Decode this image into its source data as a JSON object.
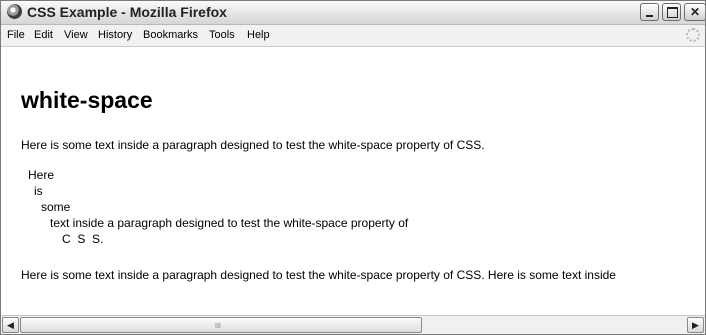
{
  "window": {
    "title": "CSS Example - Mozilla Firefox"
  },
  "menubar": {
    "items": [
      "File",
      "Edit",
      "View",
      "History",
      "Bookmarks",
      "Tools",
      "Help"
    ]
  },
  "page": {
    "heading": "white-space",
    "paragraph1": "Here is some text inside a paragraph designed to test the white-space property of CSS.",
    "pre_lines": [
      "Here",
      "is",
      "some",
      "text inside a paragraph designed to test the white-space property of",
      "C  S  S."
    ],
    "paragraph3": "Here is some text inside a paragraph designed to test the white-space property of CSS. Here is some text inside"
  },
  "scrollbar": {
    "left_icon": "left-arrow-icon",
    "right_icon": "right-arrow-icon",
    "grip": "III"
  }
}
